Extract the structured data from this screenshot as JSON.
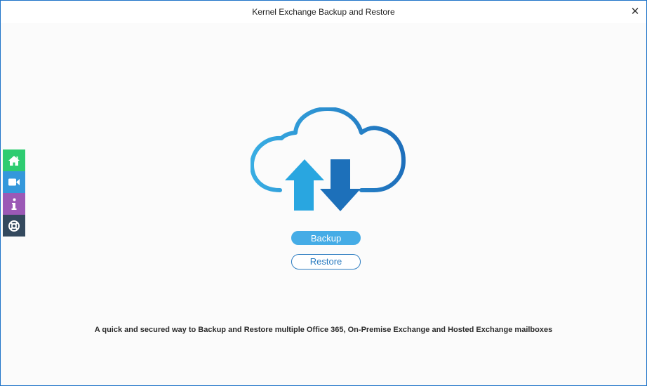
{
  "window": {
    "title": "Kernel Exchange Backup and Restore",
    "close_glyph": "✕"
  },
  "sidebar": {
    "items": [
      {
        "name": "home",
        "icon": "home-icon",
        "color": "#2ecc71"
      },
      {
        "name": "video",
        "icon": "video-icon",
        "color": "#3498db"
      },
      {
        "name": "info",
        "icon": "info-icon",
        "color": "#9b59b6"
      },
      {
        "name": "help",
        "icon": "lifebuoy-icon",
        "color": "#34495e"
      }
    ]
  },
  "main": {
    "hero_icon": "cloud-upload-download-icon",
    "backup_label": "Backup",
    "restore_label": "Restore",
    "tagline": "A quick and secured way to Backup and Restore multiple Office 365, On-Premise Exchange and Hosted Exchange mailboxes"
  },
  "colors": {
    "accent": "#45ace6",
    "accent_dark": "#1e73c8",
    "border": "#1e73c8"
  }
}
